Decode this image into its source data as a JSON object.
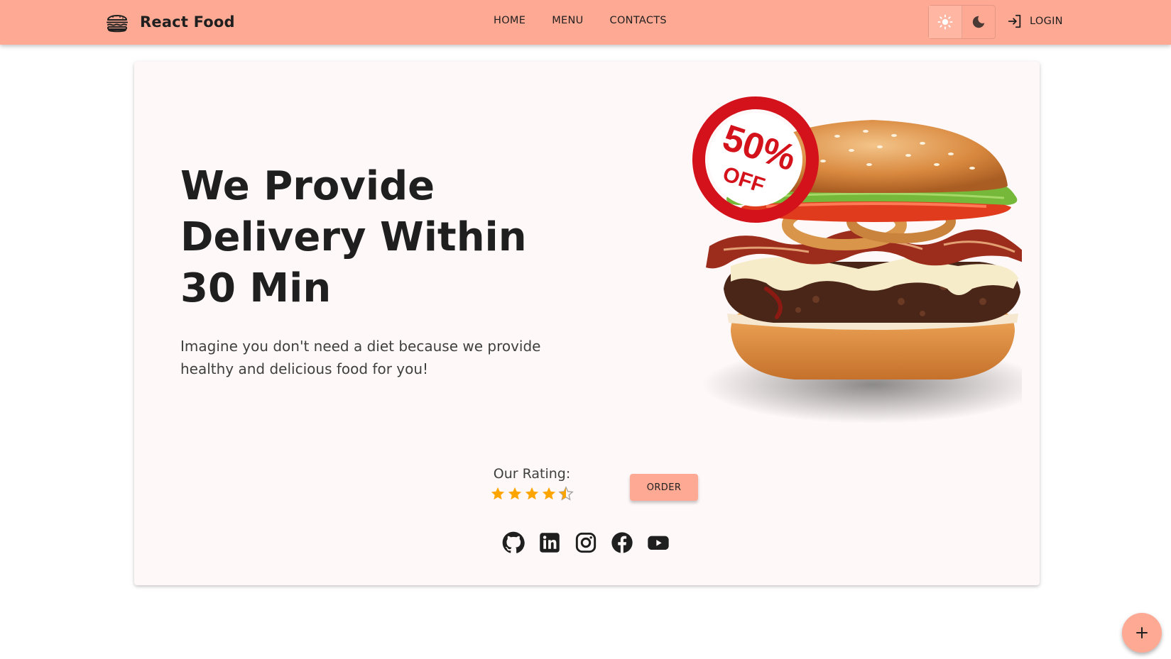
{
  "app": {
    "brand_name": "React Food",
    "brand_icon": "burger-icon"
  },
  "colors": {
    "accent": "#FEA993",
    "card_background": "#FEF8F8",
    "star": "#FFA500",
    "badge_red": "#D3121B",
    "text": "#1F1F1F"
  },
  "nav": {
    "items": [
      {
        "label": "Home"
      },
      {
        "label": "Menu"
      },
      {
        "label": "Contacts"
      }
    ]
  },
  "theme_toggle": {
    "options": [
      {
        "icon": "sun-icon",
        "selected": true
      },
      {
        "icon": "moon-icon",
        "selected": false
      }
    ]
  },
  "auth": {
    "login_label": "Login",
    "login_icon": "login-icon"
  },
  "hero": {
    "title": "We Provide Delivery Within 30 Min",
    "subtitle": "Imagine you don't need a diet because we provide healthy and delicious food for you!",
    "badge_value": "50%",
    "badge_text": "OFF"
  },
  "rating": {
    "label": "Our Rating:",
    "value": 4.5,
    "max": 5
  },
  "order_button": {
    "label": "Order"
  },
  "socials": [
    {
      "icon": "github-icon"
    },
    {
      "icon": "linkedin-icon"
    },
    {
      "icon": "instagram-icon"
    },
    {
      "icon": "facebook-icon"
    },
    {
      "icon": "youtube-icon"
    }
  ],
  "fab": {
    "icon": "plus-icon"
  }
}
